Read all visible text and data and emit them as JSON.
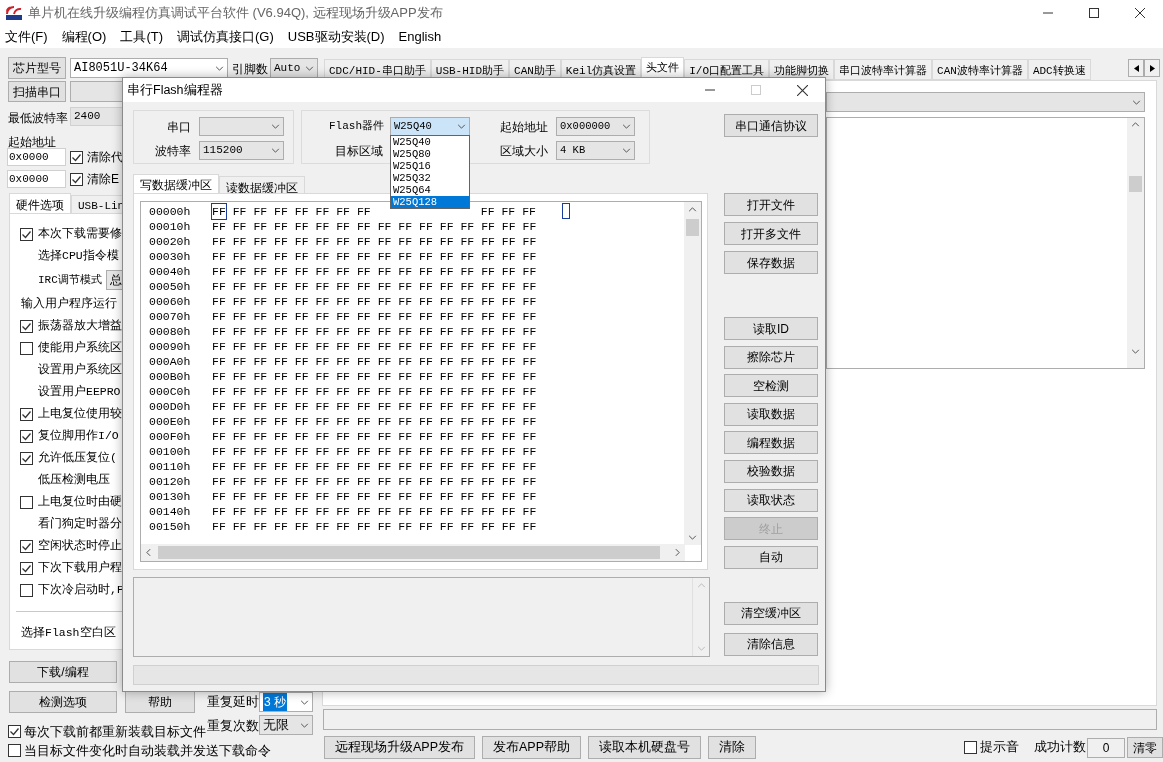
{
  "window": {
    "title": "单片机在线升级编程仿真调试平台软件 (V6.94Q), 远程现场升级APP发布"
  },
  "menu": [
    "文件(F)",
    "编程(O)",
    "工具(T)",
    "调试仿真接口(G)",
    "USB驱动安装(D)",
    "English"
  ],
  "chip": {
    "button": "芯片型号",
    "value": "AI8051U-34K64",
    "pins_label": "引脚数",
    "pins_value": "Auto"
  },
  "tabs": [
    {
      "label": "CDC/HID-串口助手",
      "selected": false
    },
    {
      "label": "USB-HID助手",
      "selected": false
    },
    {
      "label": "CAN助手",
      "selected": false
    },
    {
      "label": "Keil仿真设置",
      "selected": false
    },
    {
      "label": "头文件",
      "selected": true
    },
    {
      "label": "I/O口配置工具",
      "selected": false
    },
    {
      "label": "功能脚切换",
      "selected": false
    },
    {
      "label": "串口波特率计算器",
      "selected": false
    },
    {
      "label": "CAN波特率计算器",
      "selected": false
    },
    {
      "label": "ADC转换速",
      "selected": false
    }
  ],
  "scan_button": "扫描串口",
  "min_baud": {
    "label": "最低波特率",
    "value": "2400"
  },
  "start_address": {
    "label": "起始地址",
    "rows": [
      {
        "value": "0x0000",
        "checkbox": "清除代",
        "checked": true
      },
      {
        "value": "0x0000",
        "checkbox": "清除E",
        "checked": true
      }
    ]
  },
  "option_tabs": [
    {
      "label": "硬件选项",
      "selected": true
    },
    {
      "label": "USB-Lin",
      "selected": false
    }
  ],
  "options": [
    {
      "kind": "check",
      "label": "本次下载需要修",
      "checked": true
    },
    {
      "kind": "sub",
      "label": "选择CPU指令模"
    },
    {
      "kind": "combo",
      "label": "IRC调节模式",
      "value": "总"
    },
    {
      "kind": "label",
      "label": "输入用户程序运行"
    },
    {
      "kind": "check",
      "label": "振荡器放大增益",
      "checked": true
    },
    {
      "kind": "check",
      "label": "使能用户系统区",
      "checked": false
    },
    {
      "kind": "sub",
      "label": "设置用户系统区"
    },
    {
      "kind": "sub",
      "label": "设置用户EEPRO"
    },
    {
      "kind": "check",
      "label": "上电复位使用较",
      "checked": true
    },
    {
      "kind": "check",
      "label": "复位脚用作I/O",
      "checked": true
    },
    {
      "kind": "check",
      "label": "允许低压复位(",
      "checked": true
    },
    {
      "kind": "sub",
      "label": "低压检测电压"
    },
    {
      "kind": "check",
      "label": "上电复位时由硬",
      "checked": false
    },
    {
      "kind": "sub",
      "label": "看门狗定时器分"
    },
    {
      "kind": "check",
      "label": "空闲状态时停止",
      "checked": true
    },
    {
      "kind": "check",
      "label": "下次下载用户程",
      "checked": true
    },
    {
      "kind": "check",
      "label": "下次冷启动时,P",
      "checked": false
    },
    {
      "kind": "divider"
    },
    {
      "kind": "label",
      "label": "选择Flash空白区"
    }
  ],
  "program_buttons": [
    "下载/编程",
    "检测选项",
    "帮助"
  ],
  "repeat": {
    "delay_label": "重复延时",
    "delay_value": "3 秒",
    "count_label": "重复次数",
    "count_value": "无限"
  },
  "bottom_checks": [
    {
      "label": "每次下载前都重新装载目标文件",
      "checked": true
    },
    {
      "label": "当目标文件变化时自动装载并发送下载命令",
      "checked": false
    }
  ],
  "bottom_buttons": [
    "远程现场升级APP发布",
    "发布APP帮助",
    "读取本机硬盘号",
    "清除"
  ],
  "beep": {
    "label": "提示音",
    "checked": false
  },
  "success": {
    "label": "成功计数",
    "value": "0",
    "button": "清零"
  },
  "dialog": {
    "title": "串行Flash编程器",
    "port_label": "串口",
    "baud_label": "波特率",
    "baud_value": "115200",
    "device_label": "Flash器件",
    "device_value": "W25Q40",
    "device_options": [
      {
        "label": "W25Q40",
        "selected": false
      },
      {
        "label": "W25Q80",
        "selected": false
      },
      {
        "label": "W25Q16",
        "selected": false
      },
      {
        "label": "W25Q32",
        "selected": false
      },
      {
        "label": "W25Q64",
        "selected": false
      },
      {
        "label": "W25Q128",
        "selected": true
      }
    ],
    "target_label": "目标区域",
    "start_label": "起始地址",
    "start_value": "0x000000",
    "size_label": "区域大小",
    "size_value": "4 KB",
    "protocol_button": "串口通信协议",
    "buffer_tabs": [
      {
        "label": "写数据缓冲区",
        "selected": true
      },
      {
        "label": "读数据缓冲区",
        "selected": false
      }
    ],
    "rows": [
      {
        "address": "00000h",
        "selected_byte": "FF",
        "bytes": "FF FF FF FF FF FF FF",
        "bytes_tail": "FF FF FF"
      },
      {
        "address": "00010h",
        "bytes": "FF FF FF FF FF FF FF FF FF FF FF FF FF FF FF FF"
      },
      {
        "address": "00020h",
        "bytes": "FF FF FF FF FF FF FF FF FF FF FF FF FF FF FF FF"
      },
      {
        "address": "00030h",
        "bytes": "FF FF FF FF FF FF FF FF FF FF FF FF FF FF FF FF"
      },
      {
        "address": "00040h",
        "bytes": "FF FF FF FF FF FF FF FF FF FF FF FF FF FF FF FF"
      },
      {
        "address": "00050h",
        "bytes": "FF FF FF FF FF FF FF FF FF FF FF FF FF FF FF FF"
      },
      {
        "address": "00060h",
        "bytes": "FF FF FF FF FF FF FF FF FF FF FF FF FF FF FF FF"
      },
      {
        "address": "00070h",
        "bytes": "FF FF FF FF FF FF FF FF FF FF FF FF FF FF FF FF"
      },
      {
        "address": "00080h",
        "bytes": "FF FF FF FF FF FF FF FF FF FF FF FF FF FF FF FF"
      },
      {
        "address": "00090h",
        "bytes": "FF FF FF FF FF FF FF FF FF FF FF FF FF FF FF FF"
      },
      {
        "address": "000A0h",
        "bytes": "FF FF FF FF FF FF FF FF FF FF FF FF FF FF FF FF"
      },
      {
        "address": "000B0h",
        "bytes": "FF FF FF FF FF FF FF FF FF FF FF FF FF FF FF FF"
      },
      {
        "address": "000C0h",
        "bytes": "FF FF FF FF FF FF FF FF FF FF FF FF FF FF FF FF"
      },
      {
        "address": "000D0h",
        "bytes": "FF FF FF FF FF FF FF FF FF FF FF FF FF FF FF FF"
      },
      {
        "address": "000E0h",
        "bytes": "FF FF FF FF FF FF FF FF FF FF FF FF FF FF FF FF"
      },
      {
        "address": "000F0h",
        "bytes": "FF FF FF FF FF FF FF FF FF FF FF FF FF FF FF FF"
      },
      {
        "address": "00100h",
        "bytes": "FF FF FF FF FF FF FF FF FF FF FF FF FF FF FF FF"
      },
      {
        "address": "00110h",
        "bytes": "FF FF FF FF FF FF FF FF FF FF FF FF FF FF FF FF"
      },
      {
        "address": "00120h",
        "bytes": "FF FF FF FF FF FF FF FF FF FF FF FF FF FF FF FF"
      },
      {
        "address": "00130h",
        "bytes": "FF FF FF FF FF FF FF FF FF FF FF FF FF FF FF FF"
      },
      {
        "address": "00140h",
        "bytes": "FF FF FF FF FF FF FF FF FF FF FF FF FF FF FF FF"
      },
      {
        "address": "00150h",
        "bytes": "FF FF FF FF FF FF FF FF FF FF FF FF FF FF FF FF"
      }
    ],
    "file_buttons": [
      "打开文件",
      "打开多文件",
      "保存数据"
    ],
    "operation_buttons": [
      {
        "label": "读取ID",
        "disabled": false
      },
      {
        "label": "擦除芯片",
        "disabled": false
      },
      {
        "label": "空检测",
        "disabled": false
      },
      {
        "label": "读取数据",
        "disabled": false
      },
      {
        "label": "编程数据",
        "disabled": false
      },
      {
        "label": "校验数据",
        "disabled": false
      },
      {
        "label": "读取状态",
        "disabled": false
      },
      {
        "label": "终止",
        "disabled": true
      },
      {
        "label": "自动",
        "disabled": false
      }
    ],
    "buffer_buttons": [
      "清空缓冲区",
      "清除信息"
    ]
  }
}
